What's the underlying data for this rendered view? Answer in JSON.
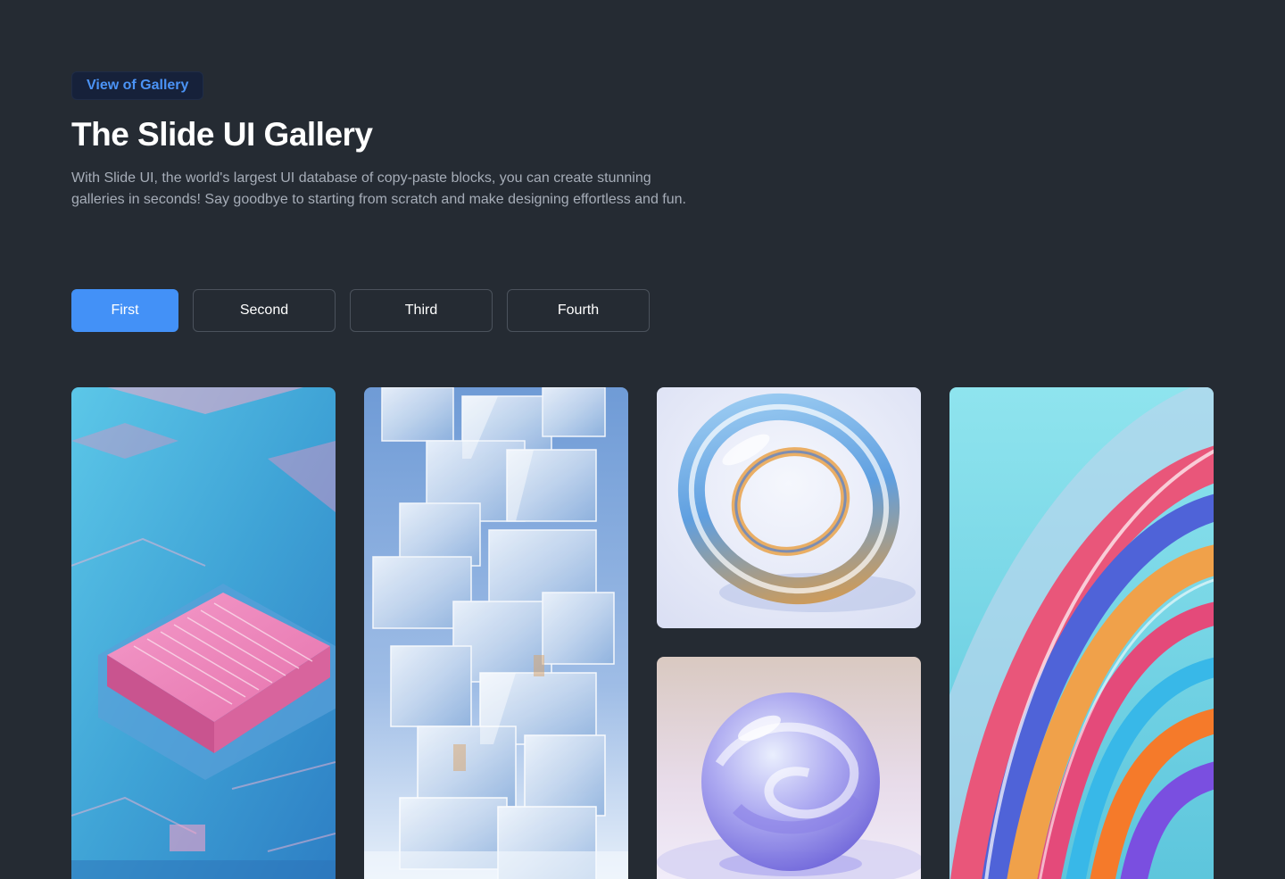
{
  "header": {
    "badge": "View of Gallery",
    "title": "The Slide UI Gallery",
    "description": "With Slide UI, the world's largest UI database of copy-paste blocks, you can create stunning galleries in seconds! Say goodbye to starting from scratch and make designing effortless and fun."
  },
  "tabs": [
    {
      "label": "First",
      "active": true
    },
    {
      "label": "Second",
      "active": false
    },
    {
      "label": "Third",
      "active": false
    },
    {
      "label": "Fourth",
      "active": false
    }
  ],
  "gallery": [
    {
      "subject": "circuit-chip"
    },
    {
      "subject": "glass-cube-tower"
    },
    {
      "subject": "glass-ring"
    },
    {
      "subject": "glass-sphere"
    },
    {
      "subject": "iridescent-wave"
    }
  ],
  "colors": {
    "background": "#252b33",
    "accent": "#4391f7",
    "badge_text": "#4b93f5",
    "text_muted": "#a6adb8"
  }
}
